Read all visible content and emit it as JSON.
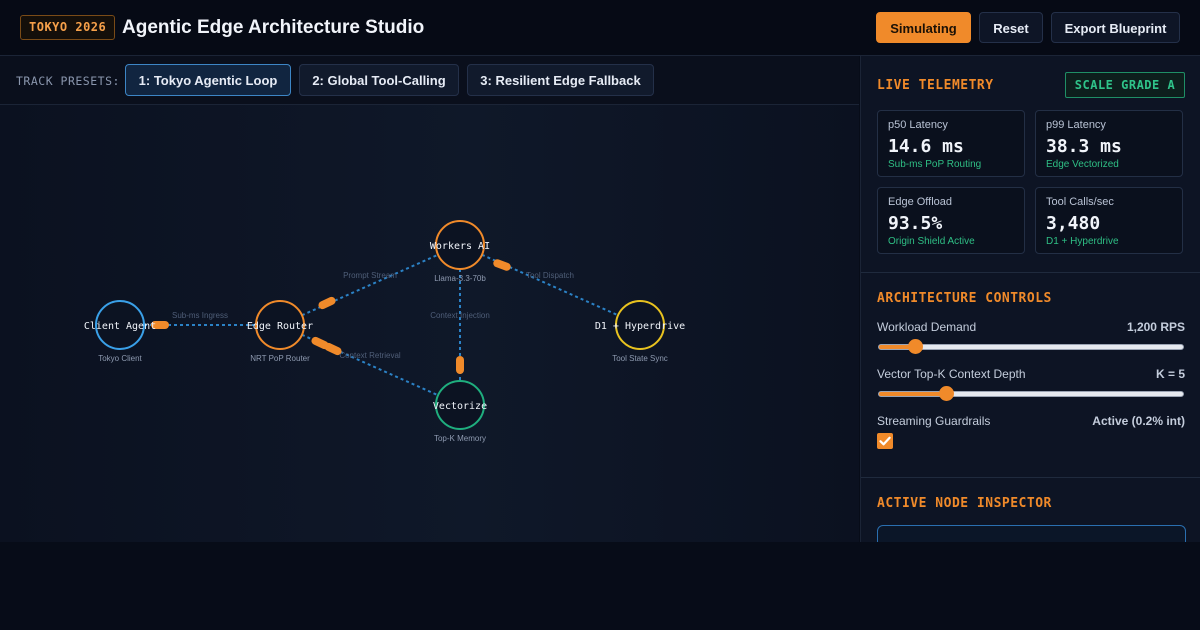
{
  "header": {
    "badge": "TOKYO 2026",
    "title": "Agentic Edge Architecture Studio",
    "buttons": {
      "simulating": "Simulating",
      "reset": "Reset",
      "export": "Export Blueprint"
    }
  },
  "presets": {
    "label": "TRACK PRESETS:",
    "items": [
      {
        "label": "1: Tokyo Agentic Loop",
        "active": true
      },
      {
        "label": "2: Global Tool-Calling",
        "active": false
      },
      {
        "label": "3: Resilient Edge Fallback",
        "active": false
      }
    ]
  },
  "graph": {
    "nodes": [
      {
        "id": "client",
        "label": "Client Agent",
        "sub": "Tokyo Client",
        "color": "#3aa0e8"
      },
      {
        "id": "router",
        "label": "Edge Router",
        "sub": "NRT PoP Router",
        "color": "#f08a2a"
      },
      {
        "id": "workers",
        "label": "Workers AI",
        "sub": "Llama-3.3-70b",
        "color": "#f08a2a"
      },
      {
        "id": "vectorize",
        "label": "Vectorize",
        "sub": "Top-K Memory",
        "color": "#1fae7e"
      },
      {
        "id": "d1",
        "label": "D1 + Hyperdrive",
        "sub": "Tool State Sync",
        "color": "#e8c21f"
      }
    ],
    "edges": [
      {
        "from": "client",
        "to": "router",
        "label": "Sub-ms Ingress"
      },
      {
        "from": "router",
        "to": "workers",
        "label": "Prompt Stream"
      },
      {
        "from": "router",
        "to": "vectorize",
        "label": "Context Retrieval"
      },
      {
        "from": "workers",
        "to": "vectorize",
        "label": "Context Injection"
      },
      {
        "from": "workers",
        "to": "d1",
        "label": "Tool Dispatch"
      }
    ],
    "line_color": "#2f8ed8",
    "packet_color": "#f08a2a"
  },
  "telemetry": {
    "heading": "LIVE TELEMETRY",
    "grade": "SCALE GRADE A",
    "cards": [
      {
        "label": "p50 Latency",
        "value": "14.6 ms",
        "sub": "Sub-ms PoP Routing"
      },
      {
        "label": "p99 Latency",
        "value": "38.3 ms",
        "sub": "Edge Vectorized"
      },
      {
        "label": "Edge Offload",
        "value": "93.5%",
        "sub": "Origin Shield Active"
      },
      {
        "label": "Tool Calls/sec",
        "value": "3,480",
        "sub": "D1 + Hyperdrive"
      }
    ]
  },
  "controls": {
    "heading": "ARCHITECTURE CONTROLS",
    "workload": {
      "label": "Workload Demand",
      "value": "1,200 RPS",
      "level": 0.12
    },
    "topk": {
      "label": "Vector Top-K Context Depth",
      "value": "K = 5",
      "level": 0.22
    },
    "guardrails": {
      "label": "Streaming Guardrails",
      "value": "Active (0.2% int)",
      "checked": true
    }
  },
  "inspector": {
    "heading": "ACTIVE NODE INSPECTOR"
  }
}
